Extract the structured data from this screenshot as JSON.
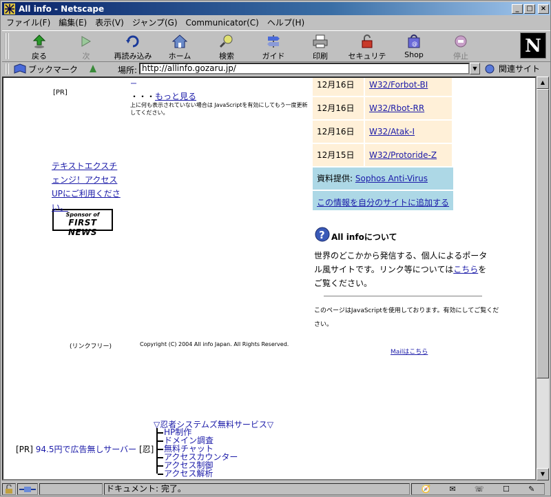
{
  "window": {
    "title": "All info - Netscape"
  },
  "menu": [
    "ファイル(F)",
    "編集(E)",
    "表示(V)",
    "ジャンプ(G)",
    "Communicator(C)",
    "ヘルプ(H)"
  ],
  "toolbar": {
    "back": "戻る",
    "forward": "次",
    "reload": "再読み込み",
    "home": "ホーム",
    "search": "検索",
    "guide": "ガイド",
    "print": "印刷",
    "security": "セキュリティ",
    "shop": "Shop",
    "stop": "停止"
  },
  "location": {
    "bookmarks": "ブックマーク",
    "label": "場所:",
    "url": "http://allinfo.gozaru.jp/",
    "related": "関連サイト"
  },
  "page": {
    "pr_label": "[PR]",
    "more_prefix": "・・・",
    "more_link": "もっと見る",
    "dash": "ー",
    "js_note": "上に何も表示されていない場合は JavaScriptを有効にしてもう一度更新してください。",
    "sponsor_small": "Sponsor of",
    "sponsor_big": "FIRST NEWS",
    "textext": "テキストエクスチェンジ！アクセスUPにご利用ください。",
    "virus_rows": [
      {
        "date": "12月16日",
        "name": "W32/Forbot-BI"
      },
      {
        "date": "12月16日",
        "name": "W32/Rbot-RR"
      },
      {
        "date": "12月16日",
        "name": "W32/Atak-I"
      },
      {
        "date": "12月15日",
        "name": "W32/Protoride-Z"
      }
    ],
    "source_prefix": "資料提供:",
    "source_link": "Sophos Anti-Virus",
    "add_link": "この情報を自分のサイトに追加する",
    "about_title": "All infoについて",
    "about_text_1": "世界のどこかから発信する、個人によるポータル風サイトです。リンク等については",
    "about_link": "こちら",
    "about_text_2": "をご覧ください。",
    "js_use_note": "このページはJavaScriptを使用しております。有効にしてご覧ください。",
    "linkfree": "(リンクフリー)",
    "copyright": "Copyright (C) 2004 All info Japan. All Rights Reserved.",
    "mail": "Mailはこちら",
    "ninja_title": "▽忍者システムズ無料サービス▽",
    "ninja_items": [
      "HP制作",
      "ドメイン調査",
      "無料チャット",
      "アクセスカウンター",
      "アクセス制御",
      "アクセス解析"
    ],
    "bottom_pr": "[PR]",
    "bottom_pr_link": "94.5円で広告無しサーバー",
    "bottom_ninja": "[忍]"
  },
  "status": {
    "text": "ドキュメント: 完了。"
  },
  "colors": {
    "title_bar": "#0a246a",
    "virus_row": "#fff0d8",
    "blue_box": "#add8e6",
    "link": "#1a1aa8"
  }
}
